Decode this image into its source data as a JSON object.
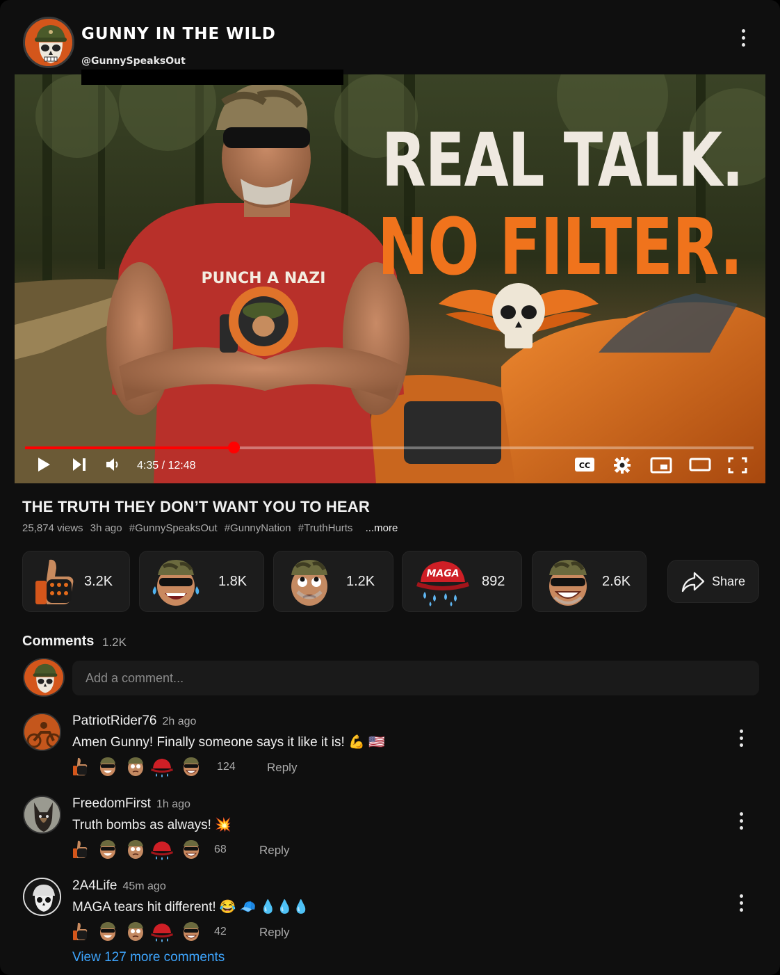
{
  "channel": {
    "title": "GUNNY IN THE WILD",
    "handle": "@GunnySpeaksOut"
  },
  "video": {
    "headline_line1": "REAL TALK.",
    "headline_line2": "NO FILTER.",
    "shirt_text": "PUNCH A NAZI",
    "progress_fraction": 0.286,
    "time": "4:35 / 12:48",
    "cc_label": "CC",
    "title": "THE TRUTH THEY DON’T WANT YOU TO HEAR",
    "views": "25,874 views",
    "age": "3h ago",
    "hashtags": [
      "#GunnySpeaksOut",
      "#GunnyNation",
      "#TruthHurts"
    ],
    "more_label": "...more"
  },
  "reactions": [
    {
      "icon": "thumbs-up-icon",
      "count": "3.2K"
    },
    {
      "icon": "laughing-tears-icon",
      "count": "1.8K"
    },
    {
      "icon": "eye-roll-icon",
      "count": "1.2K"
    },
    {
      "icon": "maga-hat-tears-icon",
      "count": "892",
      "hat_text": "MAGA"
    },
    {
      "icon": "grinning-sunglasses-icon",
      "count": "2.6K"
    }
  ],
  "share_label": "Share",
  "comments_section": {
    "heading": "Comments",
    "count": "1.2K",
    "add_placeholder": "Add a comment...",
    "items": [
      {
        "author": "PatriotRider76",
        "time": "2h ago",
        "text": "Amen Gunny! Finally someone says it like it is! 💪 🇺🇸",
        "reactions_total": "124",
        "reply_label": "Reply"
      },
      {
        "author": "FreedomFirst",
        "time": "1h ago",
        "text": "Truth bombs as always! 💥",
        "reactions_total": "68",
        "reply_label": "Reply"
      },
      {
        "author": "2A4Life",
        "time": "45m ago",
        "text": "MAGA tears hit different! 😂 🧢 💧💧💧",
        "reactions_total": "42",
        "reply_label": "Reply"
      }
    ],
    "view_more": "View 127 more comments"
  },
  "colors": {
    "accent": "#ff0000",
    "brand_orange": "#f0731c",
    "link": "#3ea6ff"
  }
}
